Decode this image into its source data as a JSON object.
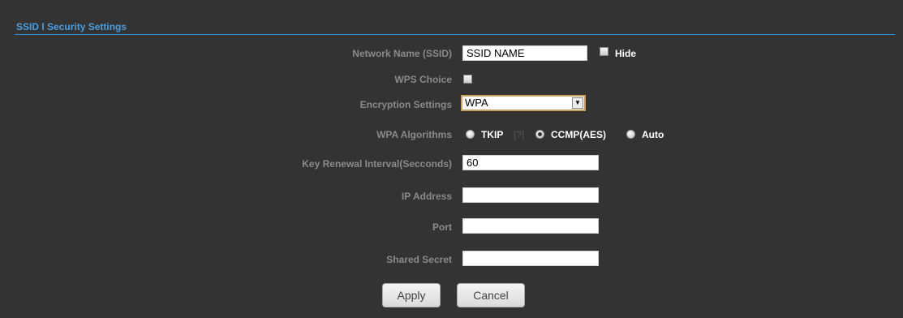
{
  "section": {
    "title": "SSID I Security Settings"
  },
  "fields": {
    "ssid": {
      "label": "Network Name (SSID)",
      "value": "SSID NAME"
    },
    "hide": {
      "label": "Hide",
      "checked": false
    },
    "wps": {
      "label": "WPS Choice",
      "checked": false
    },
    "encryption": {
      "label": "Encryption Settings",
      "selected": "WPA"
    },
    "wpa_algorithms": {
      "label": "WPA Algorithms",
      "options": [
        "TKIP",
        "CCMP(AES)",
        "Auto"
      ],
      "help": "[?]",
      "selected": "CCMP(AES)"
    },
    "key_renewal": {
      "label": "Key Renewal Interval(Secconds)",
      "value": "60"
    },
    "ip_address": {
      "label": "IP Address",
      "value": ""
    },
    "port": {
      "label": "Port",
      "value": ""
    },
    "shared_secret": {
      "label": "Shared Secret",
      "value": ""
    }
  },
  "buttons": {
    "apply": "Apply",
    "cancel": "Cancel"
  },
  "colors": {
    "background": "#333333",
    "accent": "#2f8fd8"
  }
}
